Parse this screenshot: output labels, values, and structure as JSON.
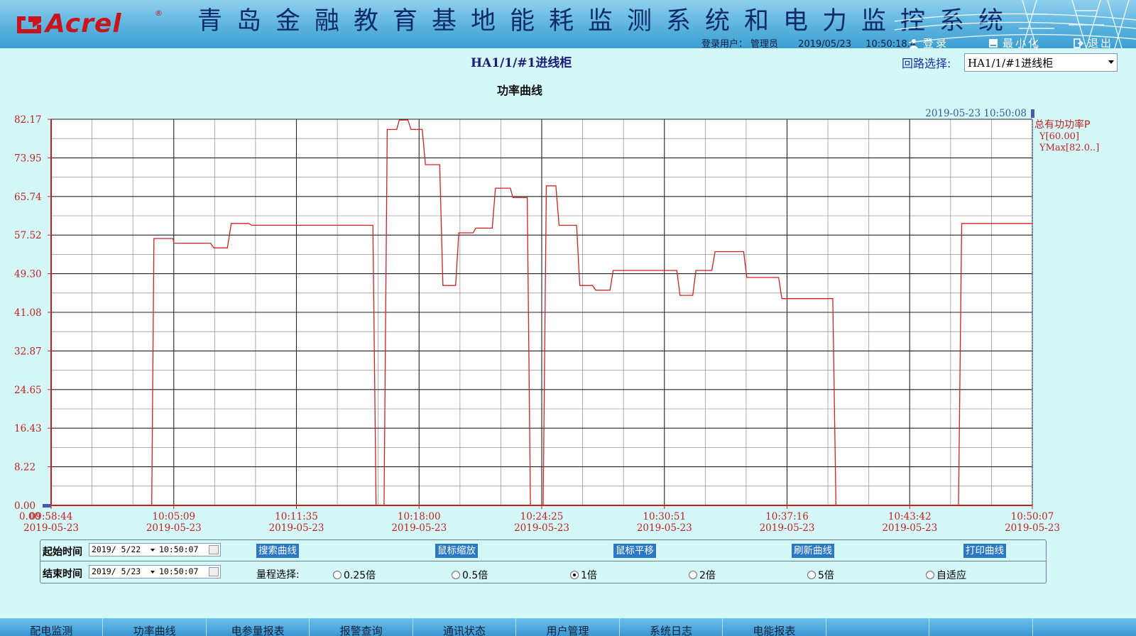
{
  "header": {
    "logo_text": "Acrel",
    "logo_reg": "®",
    "system_title": "青岛金融教育基地能耗监测系统和电力监控系统",
    "user_label": "登录用户：",
    "user_name": "管理员",
    "date": "2019/05/23",
    "time": "10:50:18.4",
    "login_label": "登录",
    "minimize_label": "最小化",
    "exit_label": "退出"
  },
  "subheader": {
    "loop_title": "HA1/1/#1进线柜",
    "loop_select_label": "回路选择:",
    "loop_select_value": "HA1/1/#1进线柜"
  },
  "chart_title": "功率曲线",
  "chart_data": {
    "type": "line",
    "title": "功率曲线",
    "xlabel": "",
    "ylabel": "",
    "ylim": [
      0,
      82.17
    ],
    "grid": true,
    "y_ticks": [
      "82.17",
      "73.95",
      "65.74",
      "57.52",
      "49.30",
      "41.08",
      "32.87",
      "24.65",
      "16.43",
      "8.22",
      "0.00"
    ],
    "y_origin_extra": "0.00",
    "x_ticks": [
      {
        "time": "09:58:44",
        "date": "2019-05-23"
      },
      {
        "time": "10:05:09",
        "date": "2019-05-23"
      },
      {
        "time": "10:11:35",
        "date": "2019-05-23"
      },
      {
        "time": "10:18:00",
        "date": "2019-05-23"
      },
      {
        "time": "10:24:25",
        "date": "2019-05-23"
      },
      {
        "time": "10:30:51",
        "date": "2019-05-23"
      },
      {
        "time": "10:37:16",
        "date": "2019-05-23"
      },
      {
        "time": "10:43:42",
        "date": "2019-05-23"
      },
      {
        "time": "10:50:07",
        "date": "2019-05-23"
      }
    ],
    "cursor_timestamp": "2019-05-23 10:50:08",
    "legend": {
      "series_name": "总有功功率P",
      "y_value": "Y[60.00]",
      "ymax": "YMax[82.0..]",
      "position": "right"
    },
    "series": [
      {
        "name": "总有功功率P",
        "color": "#d42020",
        "x": [
          "09:58:44",
          "10:04:00",
          "10:04:07",
          "10:05:07",
          "10:05:10",
          "10:07:05",
          "10:07:15",
          "10:07:58",
          "10:08:10",
          "10:09:05",
          "10:09:15",
          "10:15:35",
          "10:15:45",
          "10:16:10",
          "10:16:20",
          "10:16:50",
          "10:16:58",
          "10:17:25",
          "10:17:35",
          "10:18:10",
          "10:18:20",
          "10:19:05",
          "10:19:15",
          "10:19:55",
          "10:20:05",
          "10:20:50",
          "10:20:58",
          "10:21:50",
          "10:22:00",
          "10:22:47",
          "10:22:55",
          "10:23:40",
          "10:23:50",
          "10:24:30",
          "10:24:40",
          "10:25:10",
          "10:25:20",
          "10:26:15",
          "10:26:25",
          "10:27:05",
          "10:27:15",
          "10:28:00",
          "10:28:10",
          "10:31:30",
          "10:31:40",
          "10:32:20",
          "10:32:30",
          "10:33:20",
          "10:33:30",
          "10:35:00",
          "10:35:10",
          "10:36:50",
          "10:37:00",
          "10:37:50",
          "10:38:00",
          "10:39:40",
          "10:39:50",
          "10:46:15",
          "10:46:25",
          "10:47:15",
          "10:47:25",
          "10:50:07"
        ],
        "values": [
          0,
          0,
          56.8,
          56.8,
          55.8,
          55.8,
          54.8,
          54.8,
          60.0,
          60.0,
          59.6,
          59.6,
          0,
          0,
          80.0,
          80.0,
          82.0,
          82.0,
          80.0,
          80.0,
          72.5,
          72.5,
          46.8,
          46.8,
          58.0,
          58.0,
          59.0,
          59.0,
          67.5,
          67.5,
          65.5,
          65.5,
          0,
          0,
          68.0,
          68.0,
          59.6,
          59.6,
          46.8,
          46.8,
          45.8,
          45.8,
          50.0,
          50.0,
          44.7,
          44.7,
          50.0,
          50.0,
          54.0,
          54.0,
          48.5,
          48.5,
          44.0,
          44.0,
          44.0,
          44.0,
          0,
          0,
          60.0,
          60.0,
          60.0,
          60.0
        ]
      }
    ]
  },
  "controls": {
    "start_label": "起始时间",
    "start_date": "2019/ 5/22",
    "start_time": "10:50:07",
    "end_label": "结束时间",
    "end_date": "2019/ 5/23",
    "end_time": "10:50:07",
    "buttons": [
      "搜索曲线",
      "鼠标缩放",
      "鼠标平移",
      "刷新曲线",
      "打印曲线"
    ],
    "range_label": "量程选择:",
    "range_options": [
      "0.25倍",
      "0.5倍",
      "1倍",
      "2倍",
      "5倍",
      "自适应"
    ],
    "range_selected": "1倍"
  },
  "nav": {
    "items": [
      "配电监测",
      "功率曲线",
      "电参量报表",
      "报警查询",
      "通讯状态",
      "用户管理",
      "系统日志",
      "电能报表",
      "",
      "",
      ""
    ]
  },
  "colors": {
    "background": "#d4f7f7",
    "header": "#5bb3de",
    "series": "#d42020",
    "button": "#2c78c8"
  }
}
